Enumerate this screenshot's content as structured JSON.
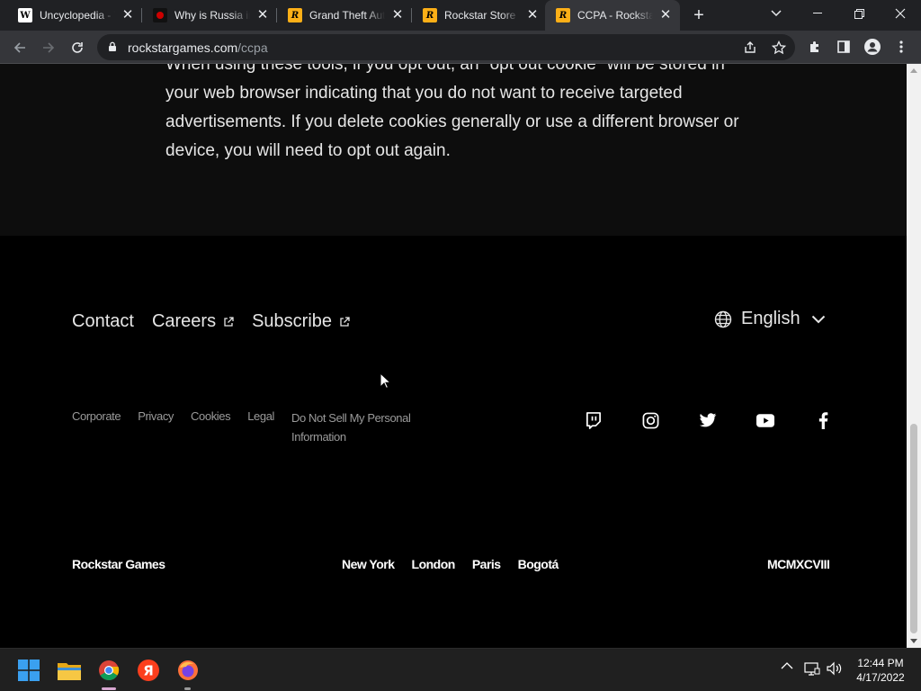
{
  "browser": {
    "tabs": [
      {
        "title": "Uncyclopedia - Y",
        "favicon": "wikipedia-w-icon"
      },
      {
        "title": "Why is Russia in",
        "favicon": "youtube-red-icon"
      },
      {
        "title": "Grand Theft Aut",
        "favicon": "rockstar-r-icon"
      },
      {
        "title": "Rockstar Store |",
        "favicon": "rockstar-r-icon"
      },
      {
        "title": "CCPA - Rockstar",
        "favicon": "rockstar-r-icon",
        "active": true
      }
    ],
    "address": {
      "host": "rockstargames.com",
      "path": "/ccpa"
    }
  },
  "page": {
    "paragraph": "When using these tools, if you opt out, an \"opt out cookie\" will be stored in your web browser indicating that you do not want to receive targeted advertisements. If you delete cookies generally or use a different browser or device, you will need to opt out again.",
    "footer": {
      "links": {
        "contact": "Contact",
        "careers": "Careers",
        "subscribe": "Subscribe"
      },
      "language": "English",
      "legal": {
        "corporate": "Corporate",
        "privacy": "Privacy",
        "cookies": "Cookies",
        "legal": "Legal",
        "do_not_sell": "Do Not Sell My Personal Information"
      },
      "social": [
        "twitch-icon",
        "instagram-icon",
        "twitter-icon",
        "youtube-icon",
        "facebook-icon"
      ],
      "company": "Rockstar Games",
      "cities": {
        "ny": "New York",
        "london": "London",
        "paris": "Paris",
        "bogota": "Bogotá"
      },
      "year": "MCMXCVIII"
    }
  },
  "taskbar": {
    "apps": [
      "windows-start-icon",
      "file-explorer-icon",
      "chrome-icon",
      "yandex-icon",
      "firefox-icon"
    ],
    "time": "12:44 PM",
    "date": "4/17/2022"
  },
  "colors": {
    "rockstar_yellow": "#fcaf17",
    "page_bg": "#000000",
    "section_bg": "#0d0d0d"
  }
}
